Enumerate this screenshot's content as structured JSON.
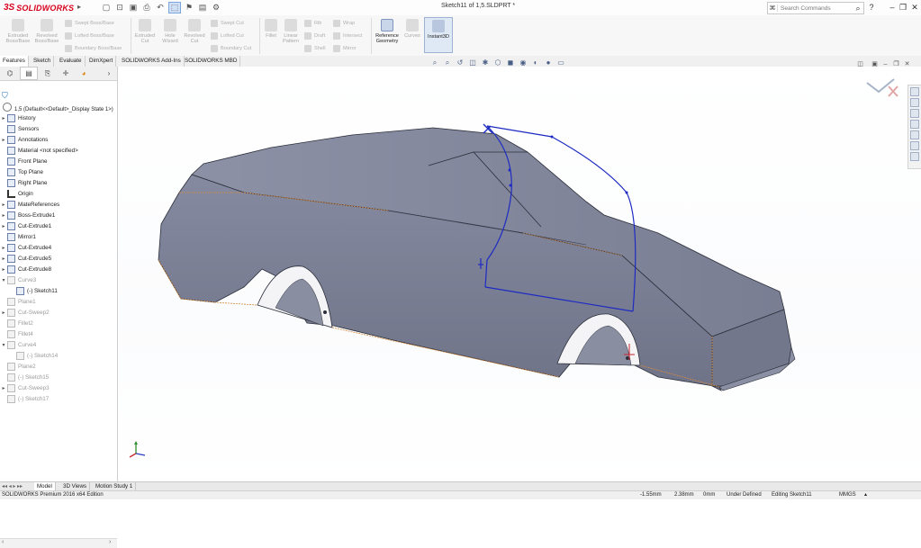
{
  "app": {
    "logo_ds": "3S",
    "logo_name": "SOLIDWORKS",
    "document_title": "Sketch11 of 1,5.SLDPRT *",
    "search_placeholder": "Search Commands",
    "help_label": "?"
  },
  "ribbon": {
    "large_buttons": [
      {
        "label": "Extruded Boss/Base"
      },
      {
        "label": "Revolved Boss/Base"
      },
      {
        "label": "Extruded Cut"
      },
      {
        "label": "Hole Wizard"
      },
      {
        "label": "Revolved Cut"
      },
      {
        "label": "Fillet"
      },
      {
        "label": "Linear Pattern"
      },
      {
        "label": "Reference Geometry"
      },
      {
        "label": "Curves"
      },
      {
        "label": "Instant3D"
      }
    ],
    "small_buttons": [
      {
        "label": "Swept Boss/Base"
      },
      {
        "label": "Lofted Boss/Base"
      },
      {
        "label": "Boundary Boss/Base"
      },
      {
        "label": "Swept Cut"
      },
      {
        "label": "Lofted Cut"
      },
      {
        "label": "Boundary Cut"
      },
      {
        "label": "Rib"
      },
      {
        "label": "Draft"
      },
      {
        "label": "Shell"
      },
      {
        "label": "Wrap"
      },
      {
        "label": "Intersect"
      },
      {
        "label": "Mirror"
      }
    ]
  },
  "tabs": [
    {
      "label": "Features"
    },
    {
      "label": "Sketch"
    },
    {
      "label": "Evaluate"
    },
    {
      "label": "DimXpert"
    },
    {
      "label": "SOLIDWORKS Add-Ins"
    },
    {
      "label": "SOLIDWORKS MBD"
    }
  ],
  "tree": {
    "root": "1,5  (Default<<Default>_Display State 1>)",
    "items": [
      {
        "label": "History"
      },
      {
        "label": "Sensors"
      },
      {
        "label": "Annotations"
      },
      {
        "label": "Material <not specified>"
      },
      {
        "label": "Front Plane"
      },
      {
        "label": "Top Plane"
      },
      {
        "label": "Right Plane"
      },
      {
        "label": "Origin"
      },
      {
        "label": "MateReferences"
      },
      {
        "label": "Boss-Extrude1"
      },
      {
        "label": "Cut-Extrude1"
      },
      {
        "label": "Mirror1"
      },
      {
        "label": "Cut-Extrude4"
      },
      {
        "label": "Cut-Extrude5"
      },
      {
        "label": "Cut-Extrude8"
      },
      {
        "label": "Curve3"
      },
      {
        "label": "(-) Sketch11"
      },
      {
        "label": "Plane1"
      },
      {
        "label": "Cut-Sweep2"
      },
      {
        "label": "Fillet2"
      },
      {
        "label": "Fillet4"
      },
      {
        "label": "Curve4"
      },
      {
        "label": "(-) Sketch14"
      },
      {
        "label": "Plane2"
      },
      {
        "label": "(-) Sketch15"
      },
      {
        "label": "Cut-Sweep3"
      },
      {
        "label": "(-) Sketch17"
      }
    ]
  },
  "bottom_tabs": [
    {
      "label": "Model"
    },
    {
      "label": "3D Views"
    },
    {
      "label": "Motion Study 1"
    }
  ],
  "status": {
    "edition": "SOLIDWORKS Premium 2016 x64 Edition",
    "x": "-1.55mm",
    "y": "2.38mm",
    "z": "0mm",
    "state": "Under Defined",
    "editing": "Editing Sketch11",
    "units": "MMGS"
  },
  "colors": {
    "body_fill": "#7f8396",
    "sketch_line": "#1d2bc2",
    "edge_orange": "#d58a3c",
    "brand_red": "#d6001c"
  },
  "icons": {
    "confirm_corner": "confirm-icon",
    "cancel_corner": "cancel-icon",
    "triad": "triad-icon"
  }
}
